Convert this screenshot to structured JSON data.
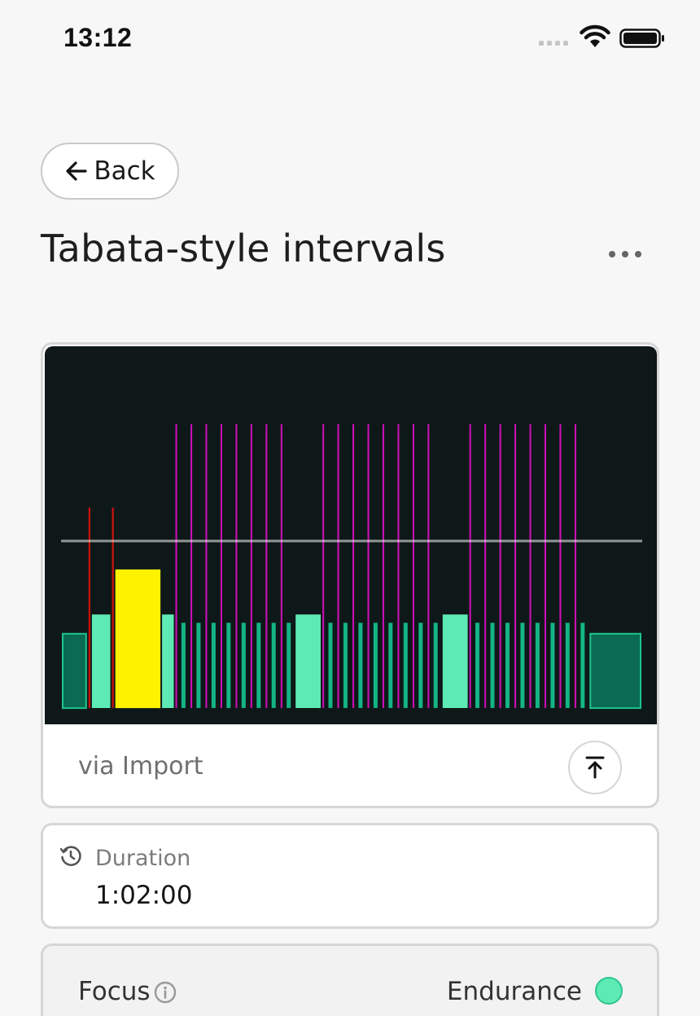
{
  "status_bar": {
    "time": "13:12"
  },
  "header": {
    "back_label": "Back",
    "title": "Tabata-style intervals"
  },
  "chart_data": {
    "type": "bar",
    "threshold_line": 1.0,
    "y_scale_note": "",
    "colors": {
      "background": "#0f1818",
      "recovery": "#0a6b52",
      "endurance": "#5eeab4",
      "tempo": "#fff200",
      "threshold": "#ffffff",
      "vo2": "#c80fb4",
      "anaerobic": "#d4120b"
    },
    "segments": [
      {
        "w": 4,
        "p": 0.45,
        "zone": "recovery",
        "outline": true
      },
      {
        "w": 0.5,
        "p": 1.2,
        "zone": "anaerobic"
      },
      {
        "w": 3,
        "p": 0.56,
        "zone": "endurance"
      },
      {
        "w": 0.5,
        "p": 1.2,
        "zone": "anaerobic"
      },
      {
        "w": 7,
        "p": 0.83,
        "zone": "tempo"
      },
      {
        "w": 2,
        "p": 0.56,
        "zone": "endurance"
      },
      {
        "block": "tabata",
        "reps": 8,
        "on_w": 0.5,
        "on_p": 1.7,
        "off_w": 1.75,
        "off_p": 0.51
      },
      {
        "w": 4,
        "p": 0.56,
        "zone": "endurance"
      },
      {
        "block": "tabata",
        "reps": 8,
        "on_w": 0.5,
        "on_p": 1.7,
        "off_w": 1.75,
        "off_p": 0.51
      },
      {
        "w": 4,
        "p": 0.56,
        "zone": "endurance"
      },
      {
        "block": "tabata",
        "reps": 8,
        "on_w": 0.5,
        "on_p": 1.7,
        "off_w": 1.75,
        "off_p": 0.51
      },
      {
        "w": 8,
        "p": 0.45,
        "zone": "recovery",
        "outline": true
      }
    ]
  },
  "card": {
    "source": "via Import"
  },
  "duration": {
    "label": "Duration",
    "value": "1:02:00"
  },
  "focus": {
    "label": "Focus",
    "value": "Endurance",
    "color": "#5eeab4"
  },
  "icons": {
    "back": "arrow-left-icon",
    "more": "more-horizontal-icon",
    "export": "upload-icon",
    "duration": "history-clock-icon",
    "info": "info-icon"
  }
}
